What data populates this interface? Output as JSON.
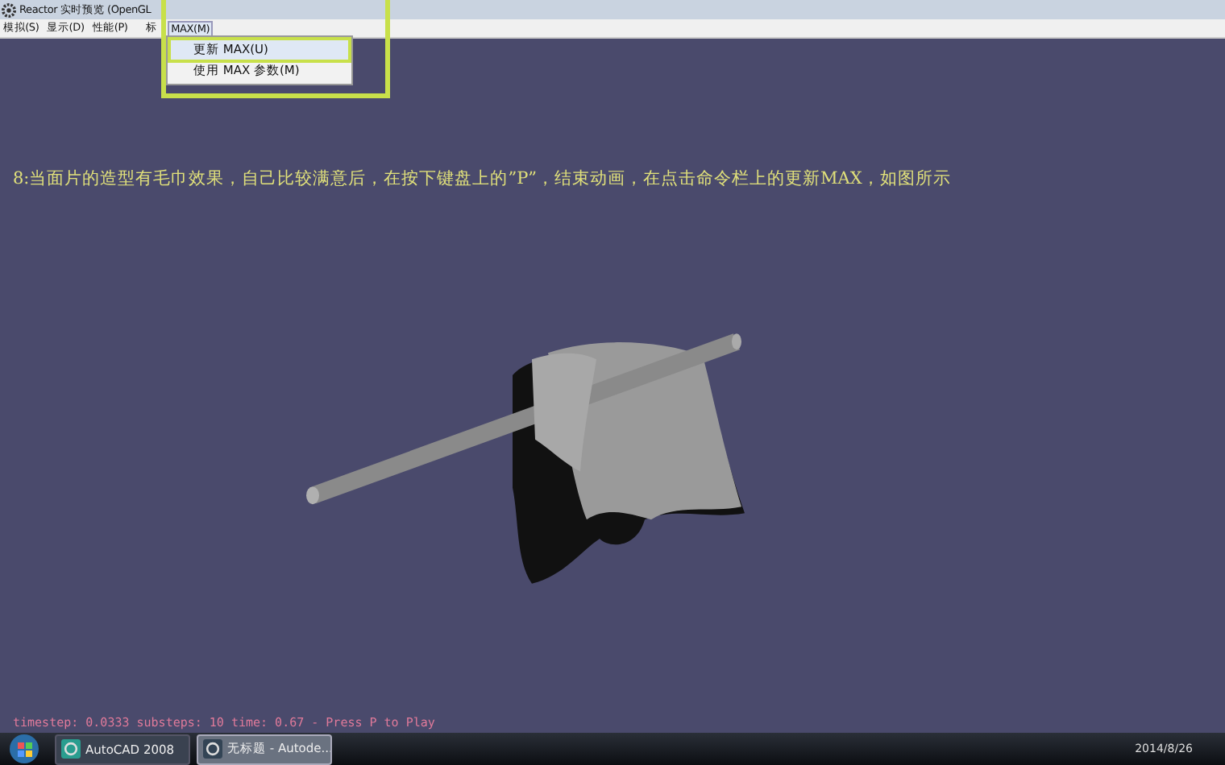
{
  "window": {
    "title": "Reactor 实时预览 (OpenGL"
  },
  "menu": [
    {
      "label": "模拟(S)",
      "selected": false
    },
    {
      "label": "显示(D)",
      "selected": false
    },
    {
      "label": "性能(P)",
      "selected": false
    },
    {
      "label": "标",
      "selected": false
    },
    {
      "label": "MAX(M)",
      "selected": true
    }
  ],
  "dropdown": [
    {
      "label": "更新 MAX(U)",
      "selected": true
    },
    {
      "label": "使用 MAX 参数(M)",
      "selected": false
    }
  ],
  "instruction": "8:当面片的造型有毛巾效果，自己比较满意后，在按下键盘上的”P”，结束动画，在点击命令栏上的更新MAX，如图所示",
  "status": "timestep: 0.0333 substeps: 10 time: 0.67 - Press P to Play",
  "taskbar": {
    "items": [
      {
        "label": "AutoCAD 2008",
        "selected": false
      },
      {
        "label": "无标题 - Autode...",
        "selected": true
      }
    ],
    "date": "2014/8/26"
  }
}
